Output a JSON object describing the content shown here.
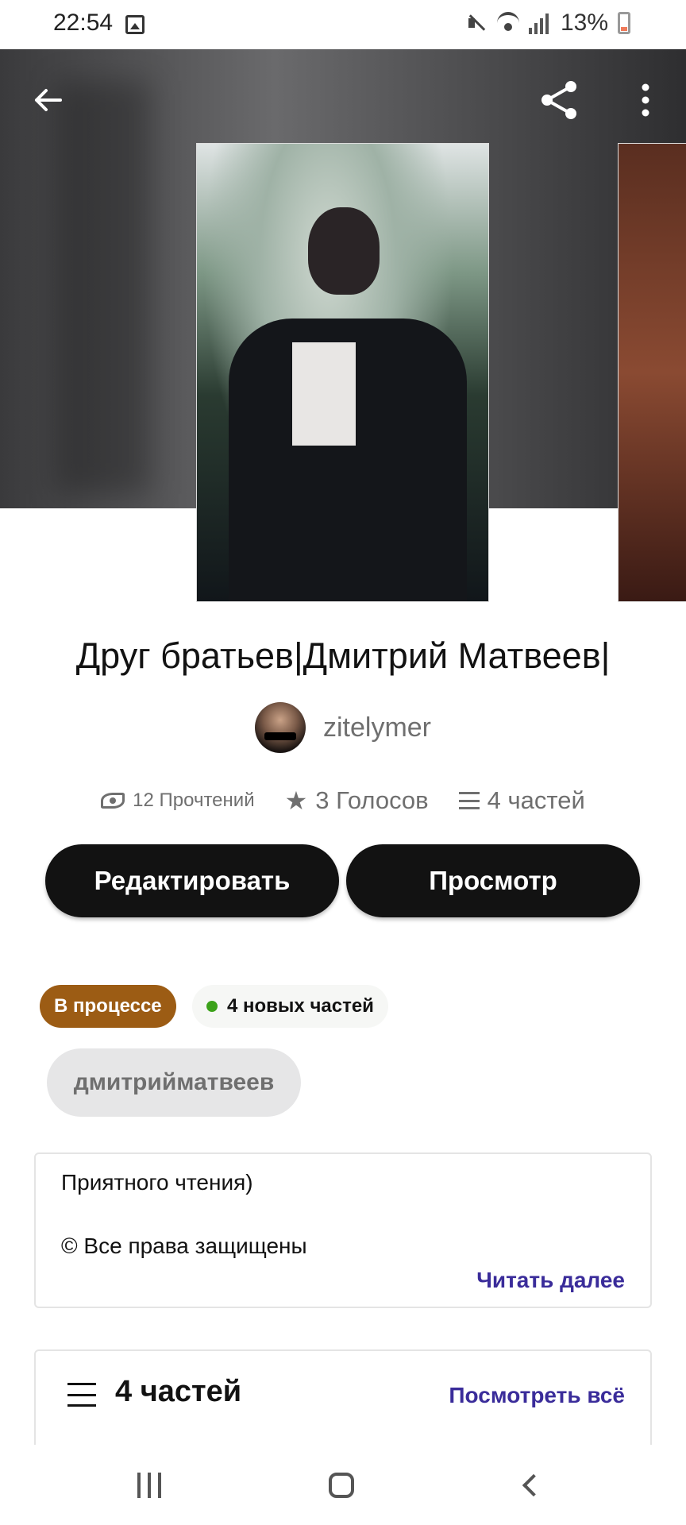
{
  "status_bar": {
    "time": "22:54",
    "battery": "13%"
  },
  "header": {
    "back_icon": "arrow-left",
    "share_icon": "share",
    "more_icon": "more-vertical"
  },
  "story": {
    "title": "Друг братьев|Дмитрий Матвеев|",
    "author": "zitelymer",
    "stats": {
      "reads": "12 Прочтений",
      "votes": "3 Голосов",
      "parts": "4 частей"
    }
  },
  "actions": {
    "edit_label": "Редактировать",
    "view_label": "Просмотр"
  },
  "status": {
    "progress_label": "В процессе",
    "new_parts_label": "4 новых частей",
    "new_dot_color": "#3ca21a",
    "progress_color": "#9c5c14"
  },
  "tags": [
    "дмитрийматвеев"
  ],
  "description": {
    "line1": "Приятного чтения)",
    "line2": "© Все права защищены",
    "read_more": "Читать далее"
  },
  "parts_section": {
    "title": "4 частей",
    "view_all": "Посмотреть всё"
  },
  "colors": {
    "accent_link": "#3a2c9a",
    "button_bg": "#121212"
  }
}
